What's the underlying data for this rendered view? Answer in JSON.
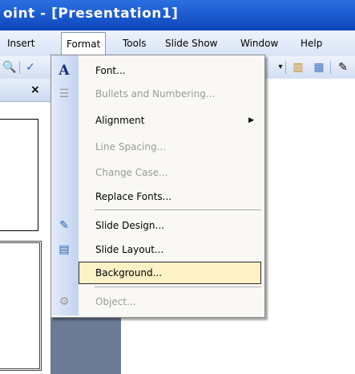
{
  "window": {
    "title": "oint - [Presentation1]"
  },
  "menubar": {
    "items": [
      {
        "label": "Insert"
      },
      {
        "label": "Format"
      },
      {
        "label": "Tools"
      },
      {
        "label": "Slide Show"
      },
      {
        "label": "Window"
      },
      {
        "label": "Help"
      }
    ]
  },
  "pane": {
    "close": "×"
  },
  "format_menu": {
    "items": [
      {
        "label": "Font...",
        "icon": "font-icon",
        "glyph": "A",
        "enabled": true
      },
      {
        "label": "Bullets and Numbering...",
        "icon": "bullets-icon",
        "glyph": "☰",
        "enabled": false
      },
      {
        "label": "Alignment",
        "submenu": true,
        "enabled": true
      },
      {
        "label": "Line Spacing...",
        "enabled": false
      },
      {
        "label": "Change Case...",
        "enabled": false
      },
      {
        "label": "Replace Fonts...",
        "enabled": true
      },
      {
        "label": "Slide Design...",
        "icon": "slide-design-icon",
        "glyph": "✎",
        "enabled": true
      },
      {
        "label": "Slide Layout...",
        "icon": "slide-layout-icon",
        "glyph": "▤",
        "enabled": true
      },
      {
        "label": "Background...",
        "enabled": true,
        "highlighted": true
      },
      {
        "label": "Object...",
        "icon": "object-icon",
        "glyph": "⚙",
        "enabled": false
      }
    ]
  },
  "colors": {
    "title_bar": "#0e46b8",
    "highlight": "#fdf1c6",
    "menu_gutter": "#c2d3f0"
  }
}
